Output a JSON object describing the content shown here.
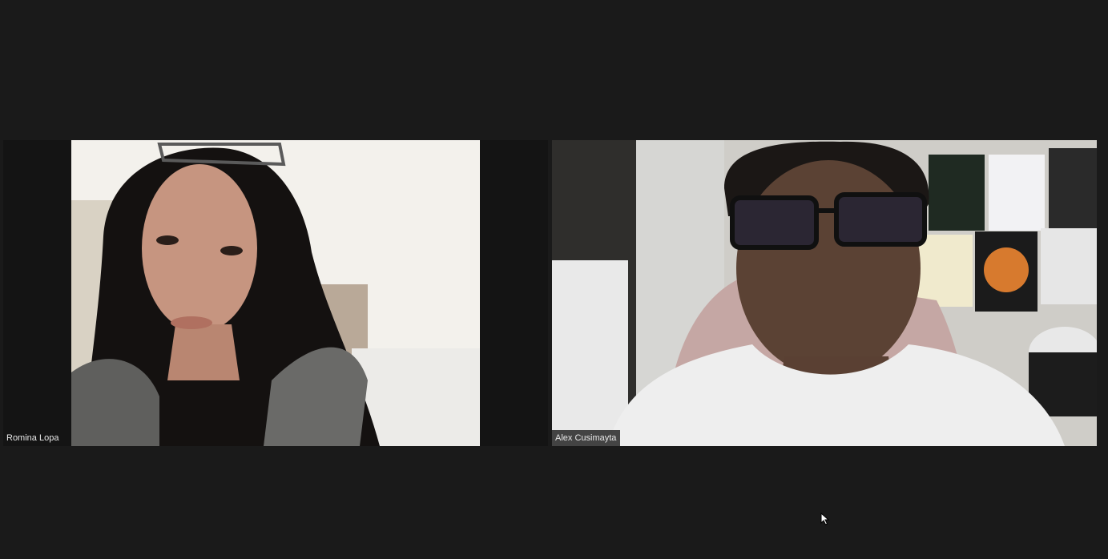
{
  "meeting": {
    "participants": [
      {
        "name": "Romina Lopa"
      },
      {
        "name": "Alex Cusimayta"
      }
    ]
  },
  "colors": {
    "background": "#1a1a1a",
    "name_tag_bg": "#141414",
    "name_tag_text": "#e8e8e8"
  },
  "icons": {
    "cursor": "mouse-pointer-icon"
  }
}
